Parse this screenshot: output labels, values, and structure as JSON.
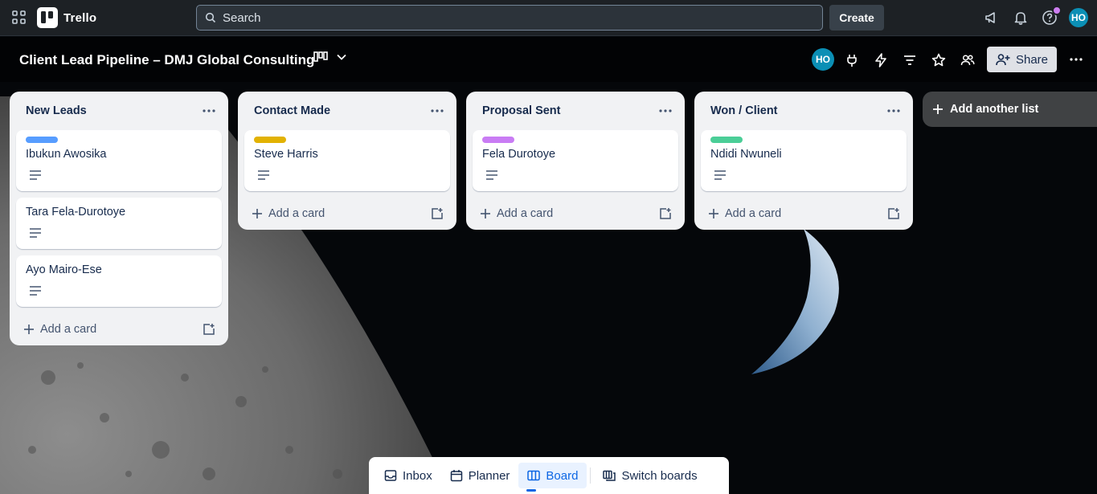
{
  "app": {
    "name": "Trello"
  },
  "topnav": {
    "search_placeholder": "Search",
    "create_label": "Create",
    "user_initials": "HO"
  },
  "board": {
    "title": "Client Lead Pipeline – DMJ Global Consulting",
    "member_initials": "HO",
    "share_label": "Share"
  },
  "lists": [
    {
      "title": "New Leads",
      "add_card_label": "Add a card",
      "cards": [
        {
          "title": "Ibukun Awosika",
          "label_color": "#579dff"
        },
        {
          "title": "Tara Fela-Durotoye"
        },
        {
          "title": "Ayo Mairo-Ese"
        }
      ]
    },
    {
      "title": "Contact Made",
      "add_card_label": "Add a card",
      "cards": [
        {
          "title": "Steve Harris",
          "label_color": "#e2b203"
        }
      ]
    },
    {
      "title": "Proposal Sent",
      "add_card_label": "Add a card",
      "cards": [
        {
          "title": "Fela Durotoye",
          "label_color": "#c97cf4"
        }
      ]
    },
    {
      "title": "Won / Client",
      "add_card_label": "Add a card",
      "cards": [
        {
          "title": "Ndidi Nwuneli",
          "label_color": "#4bce97"
        }
      ]
    }
  ],
  "add_list_label": "Add another list",
  "bottom_bar": {
    "inbox": "Inbox",
    "planner": "Planner",
    "board": "Board",
    "switch_boards": "Switch boards"
  },
  "colors": {
    "nav_bg": "#1d2125",
    "list_bg": "#f1f2f4",
    "accent": "#0c66e4"
  }
}
